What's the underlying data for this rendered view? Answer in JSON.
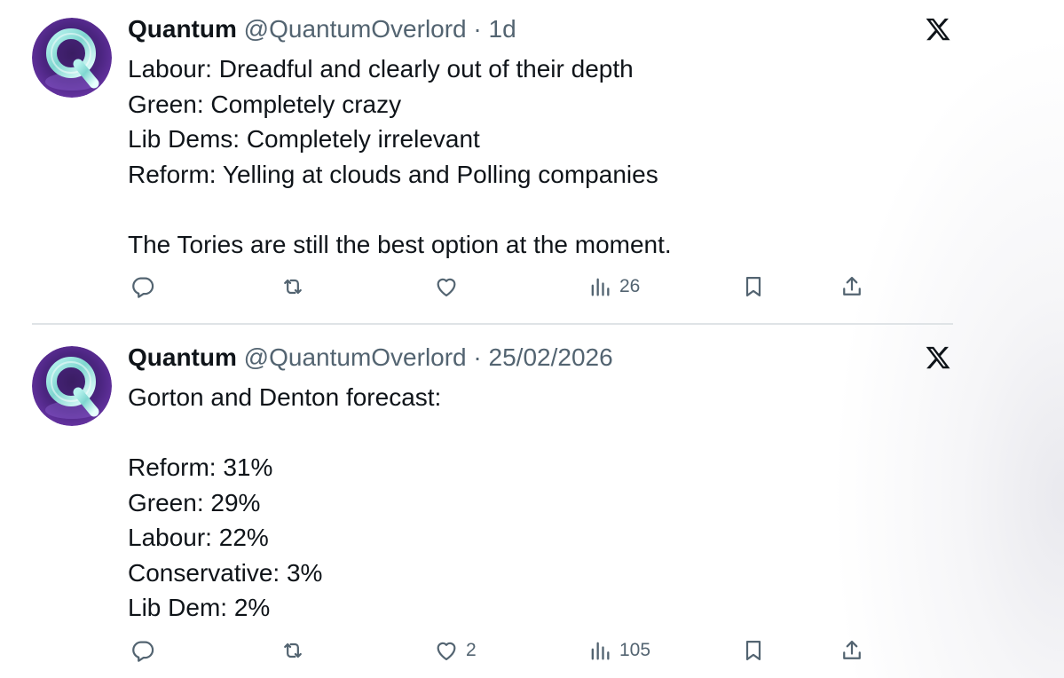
{
  "tweets": [
    {
      "author_name": "Quantum",
      "handle": "@QuantumOverlord",
      "separator": "·",
      "time": "1d",
      "lines": [
        "Labour: Dreadful and clearly out of their depth",
        "Green: Completely crazy",
        "Lib Dems: Completely irrelevant",
        "Reform: Yelling at clouds and Polling companies",
        "",
        "The Tories are still the best option at the moment."
      ],
      "actions": {
        "reply_icon": "reply-icon",
        "retweet_icon": "retweet-icon",
        "like_icon": "heart-icon",
        "like_count": "",
        "views_icon": "views-icon",
        "views_count": "26",
        "bookmark_icon": "bookmark-icon",
        "share_icon": "share-icon"
      }
    },
    {
      "author_name": "Quantum",
      "handle": "@QuantumOverlord",
      "separator": "·",
      "time": "25/02/2026",
      "lines": [
        "Gorton and Denton forecast:",
        "",
        "Reform: 31%",
        "Green: 29%",
        "Labour: 22%",
        "Conservative: 3%",
        "Lib Dem: 2%"
      ],
      "actions": {
        "reply_icon": "reply-icon",
        "retweet_icon": "retweet-icon",
        "like_icon": "heart-icon",
        "like_count": "2",
        "views_icon": "views-icon",
        "views_count": "105",
        "bookmark_icon": "bookmark-icon",
        "share_icon": "share-icon"
      }
    }
  ],
  "colors": {
    "text": "#0f1419",
    "secondary": "#536471",
    "divider": "#dfe3e6",
    "avatar_bg": "#5a2a8c"
  }
}
